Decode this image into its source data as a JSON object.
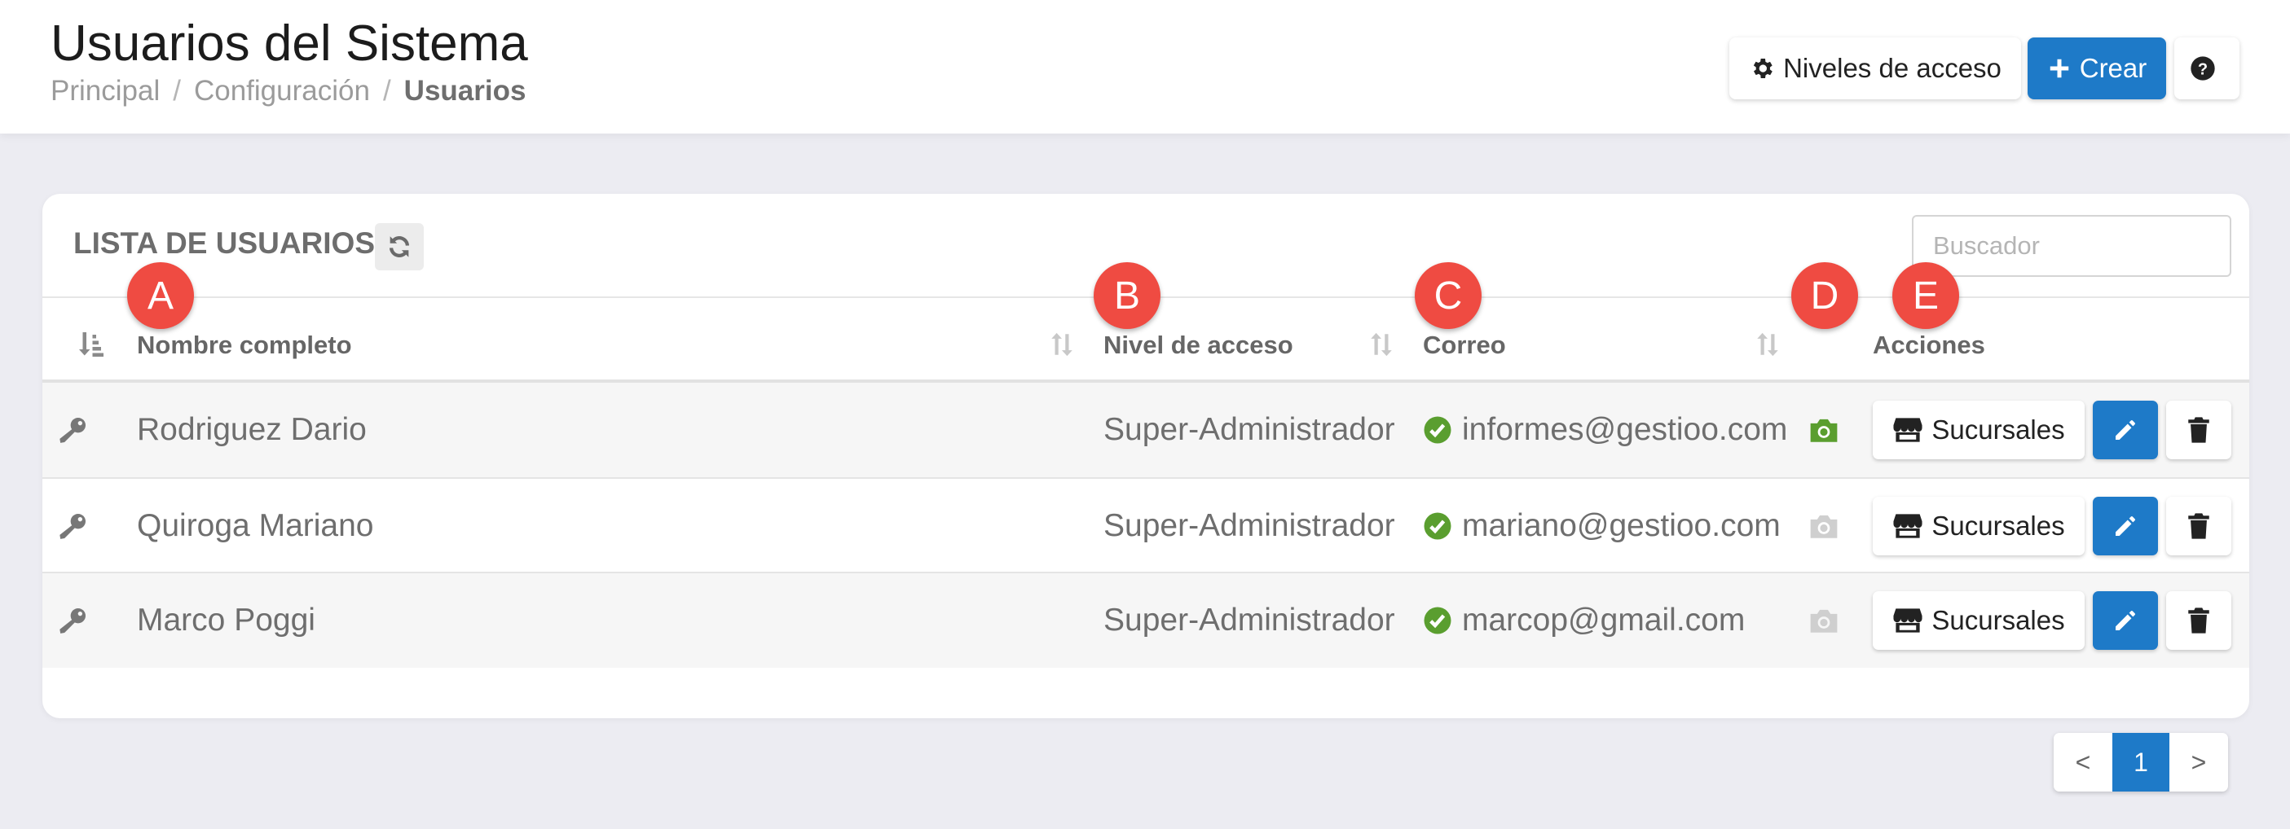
{
  "header": {
    "title": "Usuarios del Sistema",
    "breadcrumb": [
      "Principal",
      "Configuración",
      "Usuarios"
    ],
    "niveles_label": "Niveles de acceso",
    "crear_label": "Crear",
    "help_icon": "question-circle-icon"
  },
  "list": {
    "title": "LISTA DE USUARIOS",
    "search_placeholder": "Buscador",
    "columns": [
      "Nombre completo",
      "Nivel de acceso",
      "Correo",
      "Acciones"
    ],
    "badges": [
      "A",
      "B",
      "C",
      "D",
      "E"
    ],
    "rows": [
      {
        "name": "Rodriguez Dario",
        "level": "Super-Administrador",
        "email": "informes@gestioo.com",
        "photo_active": true
      },
      {
        "name": "Quiroga Mariano",
        "level": "Super-Administrador",
        "email": "mariano@gestioo.com",
        "photo_active": false
      },
      {
        "name": "Marco Poggi",
        "level": "Super-Administrador",
        "email": "marcop@gmail.com",
        "photo_active": false
      }
    ],
    "action_label": "Sucursales"
  },
  "pagination": {
    "prev": "<",
    "current": "1",
    "next": ">"
  },
  "colors": {
    "primary": "#1e7ac8",
    "success": "#5a9e2f",
    "badge": "#ef4b42",
    "muted_icon": "#c8c8c8"
  }
}
